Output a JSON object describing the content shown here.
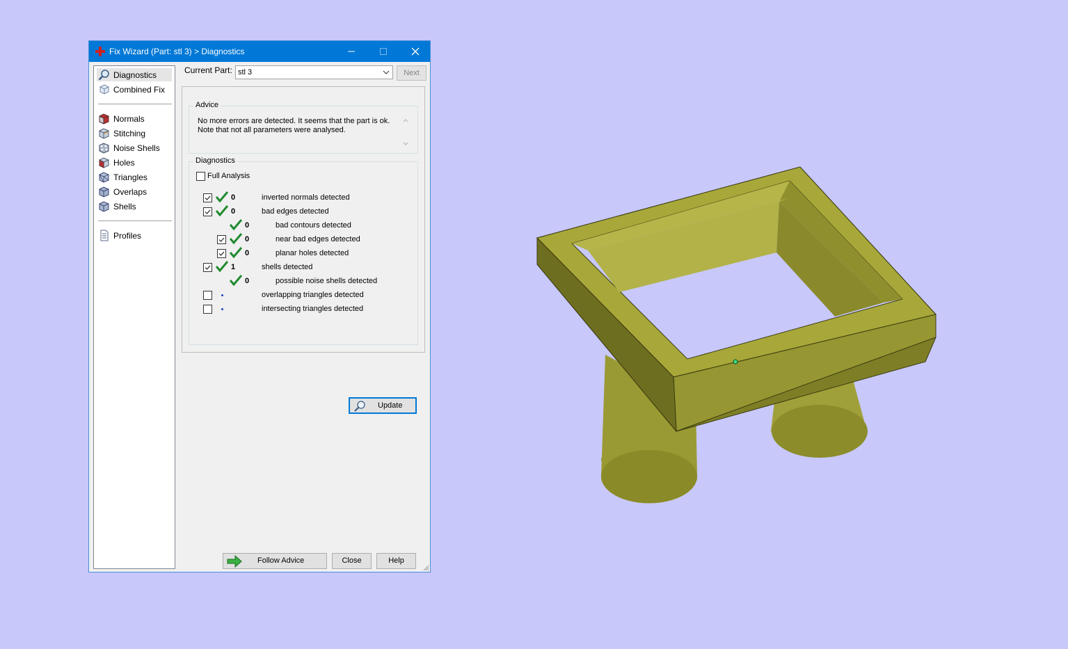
{
  "window": {
    "title": "Fix Wizard (Part: stl 3) > Diagnostics",
    "app_icon": "red-cross-icon"
  },
  "nav": {
    "top": [
      {
        "label": "Diagnostics",
        "icon": "magnifier-icon",
        "selected": true
      },
      {
        "label": "Combined Fix",
        "icon": "cube-fix-icon"
      }
    ],
    "fixes": [
      {
        "label": "Normals",
        "icon": "normals-cube-icon"
      },
      {
        "label": "Stitching",
        "icon": "stitching-cube-icon"
      },
      {
        "label": "Noise Shells",
        "icon": "noise-shells-icon"
      },
      {
        "label": "Holes",
        "icon": "holes-cube-icon"
      },
      {
        "label": "Triangles",
        "icon": "triangles-cube-icon"
      },
      {
        "label": "Overlaps",
        "icon": "overlaps-cube-icon"
      },
      {
        "label": "Shells",
        "icon": "shells-cube-icon"
      }
    ],
    "bottom": [
      {
        "label": "Profiles",
        "icon": "document-icon"
      }
    ]
  },
  "current_part": {
    "label": "Current Part:",
    "value": "stl 3",
    "next_label": "Next"
  },
  "advice": {
    "title": "Advice",
    "text": "No more errors are detected. It seems that the part is ok. Note that not all parameters were analysed."
  },
  "diagnostics": {
    "title": "Diagnostics",
    "full_analysis_label": "Full Analysis",
    "full_analysis_checked": false,
    "rows": [
      {
        "checkbox": true,
        "checked": true,
        "status": "ok",
        "count": "0",
        "label": "inverted normals detected",
        "indent": 0
      },
      {
        "checkbox": true,
        "checked": true,
        "status": "ok",
        "count": "0",
        "label": "bad edges detected",
        "indent": 0
      },
      {
        "checkbox": false,
        "checked": false,
        "status": "ok",
        "count": "0",
        "label": "bad contours detected",
        "indent": 1
      },
      {
        "checkbox": true,
        "checked": true,
        "status": "ok",
        "count": "0",
        "label": "near bad edges detected",
        "indent": 1
      },
      {
        "checkbox": true,
        "checked": true,
        "status": "ok",
        "count": "0",
        "label": "planar holes detected",
        "indent": 1
      },
      {
        "checkbox": true,
        "checked": true,
        "status": "ok",
        "count": "1",
        "label": "shells detected",
        "indent": 0
      },
      {
        "checkbox": false,
        "checked": false,
        "status": "ok",
        "count": "0",
        "label": "possible noise shells detected",
        "indent": 1
      },
      {
        "checkbox": true,
        "checked": false,
        "status": "unknown",
        "count": "",
        "label": "overlapping triangles detected",
        "indent": 0
      },
      {
        "checkbox": true,
        "checked": false,
        "status": "unknown",
        "count": "",
        "label": "intersecting triangles detected",
        "indent": 0
      }
    ],
    "update_label": "Update"
  },
  "footer": {
    "follow_advice_label": "Follow Advice",
    "close_label": "Close",
    "help_label": "Help"
  },
  "colors": {
    "background": "#c8c8fa",
    "titlebar": "#0078d7",
    "model": "#a3a33a",
    "check": "#1f8a2e"
  }
}
